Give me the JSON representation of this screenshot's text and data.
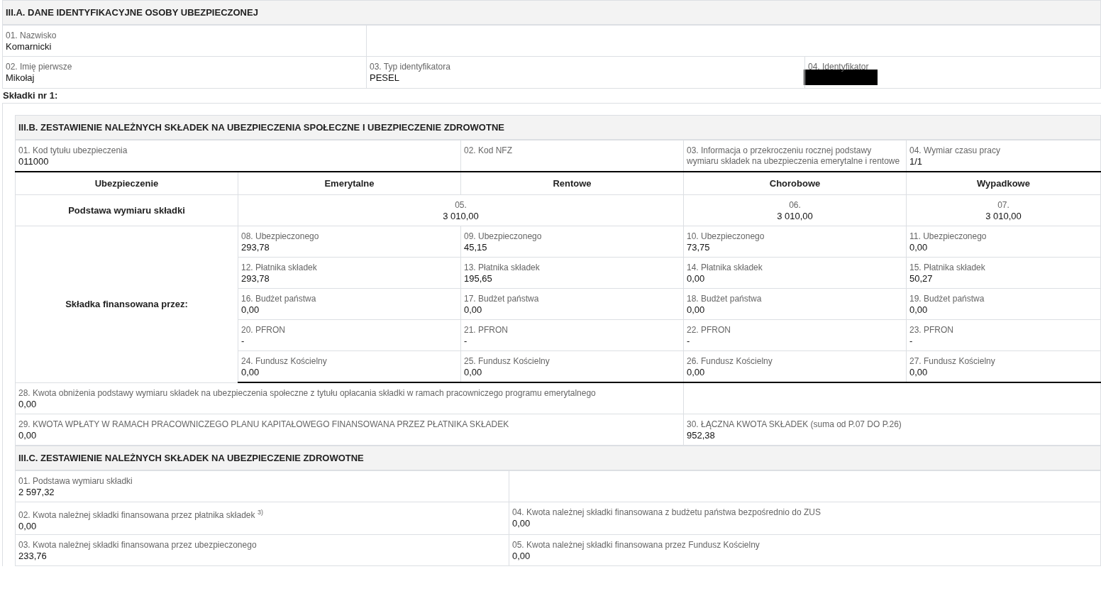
{
  "section_a": {
    "title": "III.A. DANE IDENTYFIKACYJNE OSOBY UBEZPIECZONEJ",
    "fields": [
      {
        "label": "01. Nazwisko",
        "value": "Komarnicki",
        "redacted": false
      },
      {
        "label": "02. Imię pierwsze",
        "value": "Mikołaj",
        "redacted": false
      },
      {
        "label": "03. Typ identyfikatora",
        "value": "PESEL",
        "redacted": false
      },
      {
        "label": "04. Identyfikator",
        "redacted": true
      }
    ]
  },
  "contributions_heading": "Składki nr 1:",
  "section_b": {
    "title": "III.B. ZESTAWIENIE NALEŻNYCH SKŁADEK NA UBEZPIECZENIA SPOŁECZNE I UBEZPIECZENIE ZDROWOTNE",
    "info_fields": [
      {
        "label": "01. Kod tytułu ubezpieczenia",
        "value": "011000"
      },
      {
        "label": "02. Kod NFZ"
      },
      {
        "label": "03. Informacja o przekroczeniu rocznej podstawy wymiaru składek na ubezpieczenia emerytalne i rentowe"
      },
      {
        "label": "04. Wymiar czasu pracy",
        "value": "1/1"
      }
    ],
    "columns": [
      "Ubezpieczenie",
      "Emerytalne",
      "Rentowe",
      "Chorobowe",
      "Wypadkowe"
    ],
    "base_row": {
      "label": "Podstawa wymiaru składki",
      "fields": [
        {
          "label": "05.",
          "value": "3 010,00"
        },
        {
          "label": "06.",
          "value": "3 010,00"
        },
        {
          "label": "07.",
          "value": "3 010,00"
        }
      ]
    },
    "financed_by": {
      "label": "Składka finansowana przez:",
      "rows": [
        [
          {
            "label": "08. Ubezpieczonego",
            "value": "293,78"
          },
          {
            "label": "09. Ubezpieczonego",
            "value": "45,15"
          },
          {
            "label": "10. Ubezpieczonego",
            "value": "73,75"
          },
          {
            "label": "11. Ubezpieczonego",
            "value": "0,00"
          }
        ],
        [
          {
            "label": "12. Płatnika składek",
            "value": "293,78"
          },
          {
            "label": "13. Płatnika składek",
            "value": "195,65"
          },
          {
            "label": "14. Płatnika składek",
            "value": "0,00"
          },
          {
            "label": "15. Płatnika składek",
            "value": "50,27"
          }
        ],
        [
          {
            "label": "16. Budżet państwa",
            "value": "0,00"
          },
          {
            "label": "17. Budżet państwa",
            "value": "0,00"
          },
          {
            "label": "18. Budżet państwa",
            "value": "0,00"
          },
          {
            "label": "19. Budżet państwa",
            "value": "0,00"
          }
        ],
        [
          {
            "label": "20. PFRON",
            "value": "-"
          },
          {
            "label": "21. PFRON",
            "value": "-"
          },
          {
            "label": "22. PFRON",
            "value": "-"
          },
          {
            "label": "23. PFRON",
            "value": "-"
          }
        ],
        [
          {
            "label": "24. Fundusz Kościelny",
            "value": "0,00"
          },
          {
            "label": "25. Fundusz Kościelny",
            "value": "0,00"
          },
          {
            "label": "26. Fundusz Kościelny",
            "value": "0,00"
          },
          {
            "label": "27. Fundusz Kościelny",
            "value": "0,00"
          }
        ]
      ]
    },
    "bottom_fields": [
      {
        "label": "28. Kwota obniżenia podstawy wymiaru składek na ubezpieczenia społeczne z tytułu opłacania składki w ramach pracowniczego programu emerytalnego",
        "value": "0,00"
      },
      {
        "label": "29. KWOTA WPŁATY W RAMACH PRACOWNICZEGO PLANU KAPITAŁOWEGO FINANSOWANA PRZEZ PŁATNIKA SKŁADEK",
        "value": "0,00"
      },
      {
        "label": "30. ŁĄCZNA KWOTA SKŁADEK (suma od P.07 DO P.26)",
        "value": "952,38"
      }
    ]
  },
  "section_c": {
    "title": "III.C. ZESTAWIENIE NALEŻNYCH SKŁADEK NA UBEZPIECZENIE ZDROWOTNE",
    "fields": [
      {
        "label": "01. Podstawa wymiaru składki",
        "value": "2 597,32"
      },
      {
        "label": "02. Kwota należnej składki finansowana przez płatnika składek $^{3)}$",
        "value": "0,00"
      },
      {
        "label": "04. Kwota należnej składki finansowana z budżetu państwa bezpośrednio do ZUS",
        "value": "0,00"
      },
      {
        "label": "03. Kwota należnej składki finansowana przez ubezpieczonego",
        "value": "233,76"
      },
      {
        "label": "05. Kwota należnej składki finansowana przez Fundusz Kościelny",
        "value": "0,00"
      }
    ]
  }
}
